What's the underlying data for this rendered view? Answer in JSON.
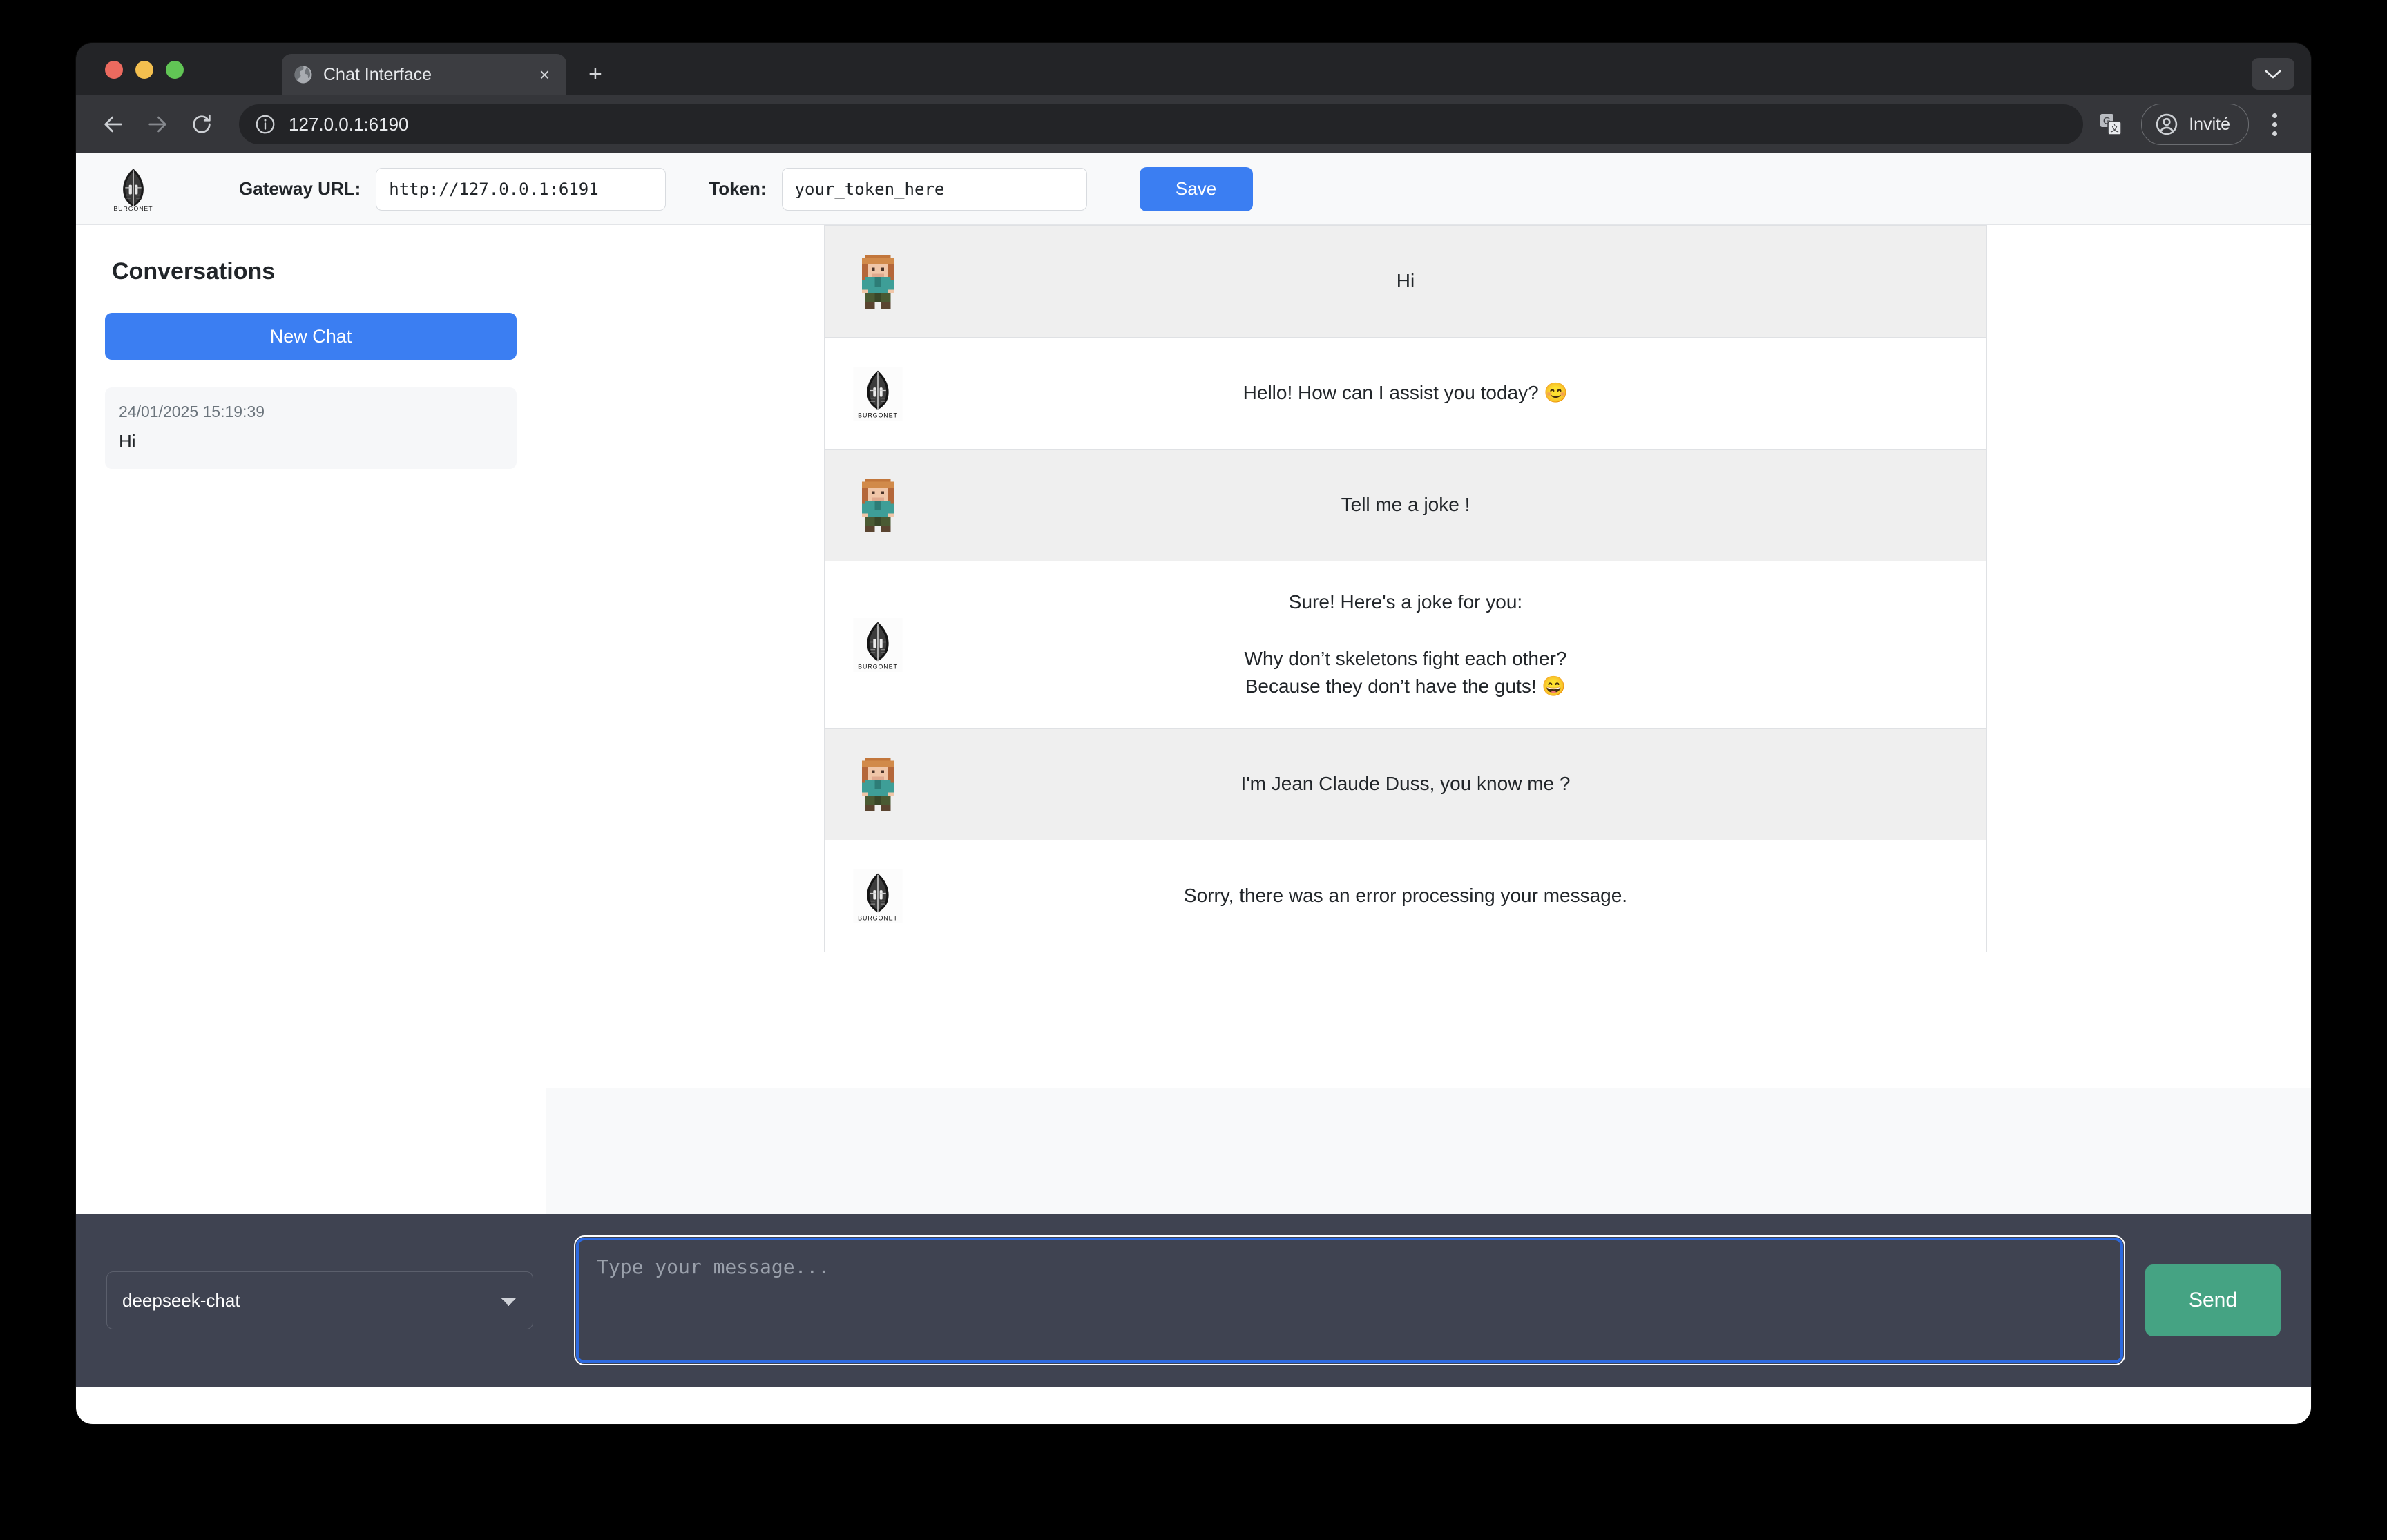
{
  "browser": {
    "tab": {
      "title": "Chat Interface",
      "favicon_icon": "globe-icon",
      "close_icon": "×"
    },
    "new_tab_icon": "+",
    "window_caret_icon": "chevron-down-icon",
    "back_icon": "arrow-left-icon",
    "forward_icon": "arrow-right-icon",
    "reload_icon": "reload-icon",
    "site_info_icon": "info-circle-icon",
    "url": "127.0.0.1:6190",
    "translate_icon": "translate-icon",
    "profile_label": "Invité",
    "profile_icon": "account-circle-icon",
    "menu_icon": "kebab-menu-icon"
  },
  "app_header": {
    "logo_name": "burgonet-logo",
    "logo_text": "BURGONET",
    "gateway_label": "Gateway URL:",
    "gateway_value": "http://127.0.0.1:6191",
    "gateway_placeholder": "http://127.0.0.1:6191",
    "token_label": "Token:",
    "token_value": "your_token_here",
    "token_placeholder": "your_token_here",
    "save_label": "Save",
    "accent_blue": "#3b7ef2"
  },
  "sidebar": {
    "title": "Conversations",
    "new_chat_label": "New Chat",
    "conversations": [
      {
        "time": "24/01/2025 15:19:39",
        "preview": "Hi"
      }
    ]
  },
  "chat": {
    "messages": [
      {
        "role": "user",
        "avatar": "user-avatar",
        "text": "Hi"
      },
      {
        "role": "bot",
        "avatar": "burgonet-avatar",
        "text": "Hello! How can I assist you today? 😊"
      },
      {
        "role": "user",
        "avatar": "user-avatar",
        "text": "Tell me a joke !"
      },
      {
        "role": "bot",
        "avatar": "burgonet-avatar",
        "text": "Sure! Here's a joke for you:\n\nWhy don’t skeletons fight each other?\nBecause they don’t have the guts! 😄"
      },
      {
        "role": "user",
        "avatar": "user-avatar",
        "text": "I'm Jean Claude Duss, you know me ?"
      },
      {
        "role": "bot",
        "avatar": "burgonet-avatar",
        "text": "Sorry, there was an error processing your message."
      }
    ]
  },
  "composer": {
    "model_selected": "deepseek-chat",
    "model_options": [
      "deepseek-chat"
    ],
    "input_value": "",
    "input_placeholder": "Type your message...",
    "send_label": "Send",
    "send_color": "#45a383",
    "footer_color": "#3f4351"
  }
}
